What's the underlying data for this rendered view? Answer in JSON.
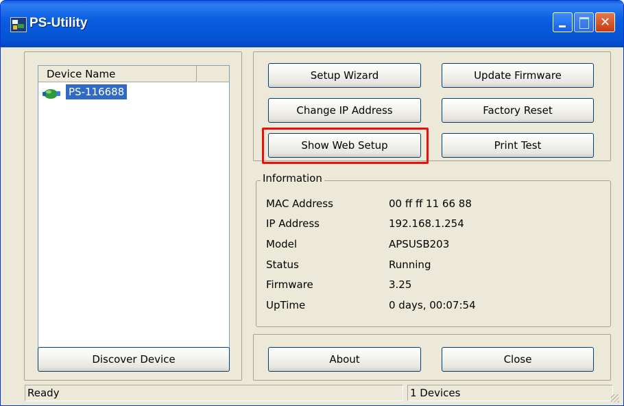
{
  "window": {
    "title": "PS-Utility"
  },
  "device_list": {
    "column_header": "Device Name",
    "items": [
      {
        "label": "PS-116688",
        "selected": true
      }
    ]
  },
  "actions": {
    "setup_wizard": "Setup Wizard",
    "update_firmware": "Update Firmware",
    "change_ip": "Change IP Address",
    "factory_reset": "Factory Reset",
    "show_web_setup": "Show Web Setup",
    "print_test": "Print Test"
  },
  "information": {
    "title": "Information",
    "rows": [
      {
        "label": "MAC Address",
        "value": "00 ff ff 11 66 88"
      },
      {
        "label": "IP Address",
        "value": "192.168.1.254"
      },
      {
        "label": "Model",
        "value": "APSUSB203"
      },
      {
        "label": "Status",
        "value": "Running"
      },
      {
        "label": "Firmware",
        "value": "3.25"
      },
      {
        "label": "UpTime",
        "value": "0 days, 00:07:54"
      }
    ]
  },
  "bottom_buttons": {
    "discover": "Discover Device",
    "about": "About",
    "close": "Close"
  },
  "statusbar": {
    "status": "Ready",
    "device_count": "1 Devices"
  },
  "colors": {
    "titlebar": "#0a5ee0",
    "selection": "#316ac5",
    "highlight_box": "#e8100c",
    "window_bg": "#ece9d8"
  }
}
